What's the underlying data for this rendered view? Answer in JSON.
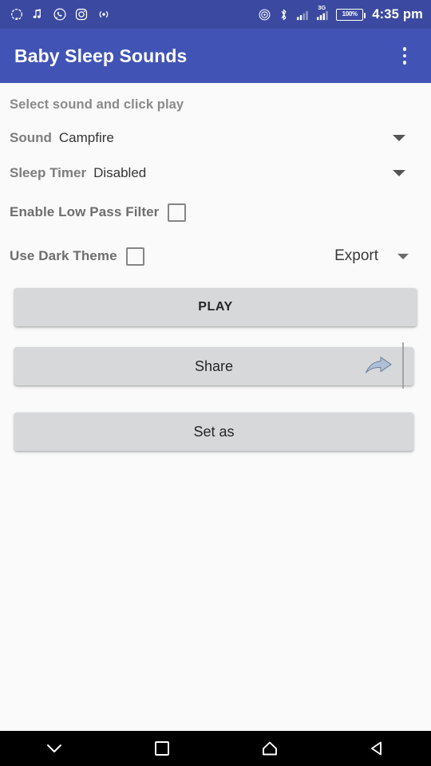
{
  "statusbar": {
    "left_icons": [
      {
        "name": "sync-dotted-circle-icon"
      },
      {
        "name": "music-note-icon"
      },
      {
        "name": "whatsapp-icon"
      },
      {
        "name": "instagram-icon"
      },
      {
        "name": "broadcast-icon"
      }
    ],
    "right_icons": [
      {
        "name": "hotspot-icon"
      },
      {
        "name": "bluetooth-icon"
      },
      {
        "name": "signal-bars-icon"
      },
      {
        "name": "signal-3g-icon",
        "label": "3G"
      }
    ],
    "battery_label": "100%",
    "time": "4:35 pm",
    "background": "#3B4AA0"
  },
  "appbar": {
    "title": "Baby Sleep Sounds",
    "overflow_name": "overflow-menu-icon",
    "background": "#4154B5"
  },
  "main": {
    "hint": "Select sound and click play",
    "sound_row": {
      "label": "Sound",
      "value": "Campfire"
    },
    "timer_row": {
      "label": "Sleep Timer",
      "value": "Disabled"
    },
    "low_pass_row": {
      "label": "Enable Low Pass Filter",
      "checked": false
    },
    "dark_theme_row": {
      "label": "Use Dark Theme",
      "checked": false
    },
    "export_label": "Export",
    "buttons": {
      "play": "PLAY",
      "share": "Share",
      "set_as": "Set as"
    },
    "share_icon_color": "#AFC0D6",
    "button_color": "#D7D8D9",
    "background": "#FAFAFA"
  },
  "navbar": {
    "items": [
      {
        "name": "hide-keyboard-chevron-down-icon"
      },
      {
        "name": "recents-square-icon"
      },
      {
        "name": "home-icon"
      },
      {
        "name": "back-triangle-icon"
      }
    ],
    "background": "#000000"
  }
}
